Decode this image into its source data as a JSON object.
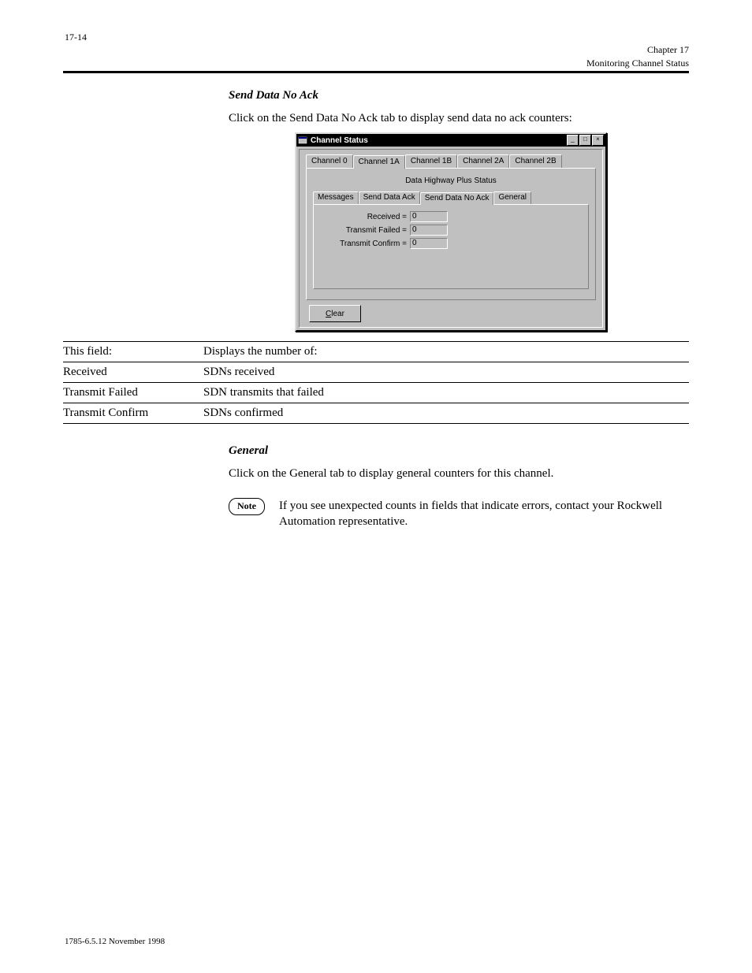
{
  "page_number": "17-14",
  "chapter_label": "Chapter 17",
  "chapter_title": "Monitoring Channel Status",
  "pub_no": "1785-6.5.12    November 1998",
  "section1": {
    "heading": "Send Data No Ack",
    "intro": "Click on the Send Data No Ack tab to display send data no ack counters:",
    "table_head_field": "This field:",
    "table_head_desc": "Displays the number of:",
    "rows": [
      {
        "f": "Received",
        "d": "SDNs received"
      },
      {
        "f": "Transmit Failed",
        "d": "SDN transmits that failed"
      },
      {
        "f": "Transmit Confirm",
        "d": "SDNs confirmed"
      }
    ]
  },
  "section2": {
    "heading": "General",
    "intro": "Click on the General tab to display general counters for this channel.",
    "note_label": "Note",
    "note_body": "If you see unexpected counts in fields that indicate errors, contact your Rockwell Automation representative."
  },
  "win": {
    "title": "Channel Status",
    "chan_tabs": [
      "Channel 0",
      "Channel 1A",
      "Channel 1B",
      "Channel 2A",
      "Channel 2B"
    ],
    "status_title": "Data Highway Plus Status",
    "sub_tabs": [
      "Messages",
      "Send Data Ack",
      "Send Data No Ack",
      "General"
    ],
    "fields": [
      {
        "label": "Received =",
        "value": "0"
      },
      {
        "label": "Transmit Failed =",
        "value": "0"
      },
      {
        "label": "Transmit Confirm =",
        "value": "0"
      }
    ],
    "clear_btn_prefix": "C",
    "clear_btn_rest": "lear"
  }
}
